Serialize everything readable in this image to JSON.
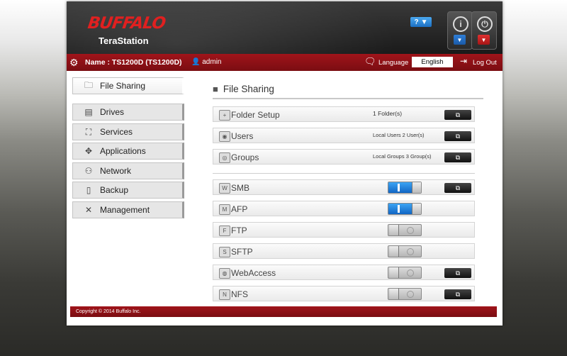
{
  "header": {
    "logo": "BUFFALO",
    "product": "TeraStation",
    "help_label": "?",
    "info_glyph": "i",
    "power_glyph": "⏻"
  },
  "namebar": {
    "name": "Name : TS1200D (TS1200D)",
    "user": "admin",
    "language_label": "Language",
    "language_value": "English",
    "logout": "Log Out"
  },
  "sidebar": {
    "items": [
      {
        "label": "File Sharing",
        "icon": "folder-icon"
      },
      {
        "label": "Drives",
        "icon": "drives-icon"
      },
      {
        "label": "Services",
        "icon": "services-icon"
      },
      {
        "label": "Applications",
        "icon": "applications-icon"
      },
      {
        "label": "Network",
        "icon": "network-icon"
      },
      {
        "label": "Backup",
        "icon": "backup-icon"
      },
      {
        "label": "Management",
        "icon": "tools-icon"
      }
    ]
  },
  "main": {
    "title": "File Sharing",
    "rows": [
      {
        "label": "Folder Setup",
        "info": "1 Folder(s)"
      },
      {
        "label": "Users",
        "info": "Local Users 2 User(s)"
      },
      {
        "label": "Groups",
        "info": "Local Groups 3 Group(s)"
      },
      {
        "label": "SMB",
        "state": "on"
      },
      {
        "label": "AFP",
        "state": "on"
      },
      {
        "label": "FTP",
        "state": "off"
      },
      {
        "label": "SFTP",
        "state": "off"
      },
      {
        "label": "WebAccess",
        "state": "off"
      },
      {
        "label": "NFS",
        "state": "off"
      }
    ]
  },
  "footer": {
    "copyright": "Copyright © 2014 Buffalo Inc."
  },
  "colors": {
    "brand_red": "#a0141a",
    "toggle_on": "#1b7ad8"
  }
}
